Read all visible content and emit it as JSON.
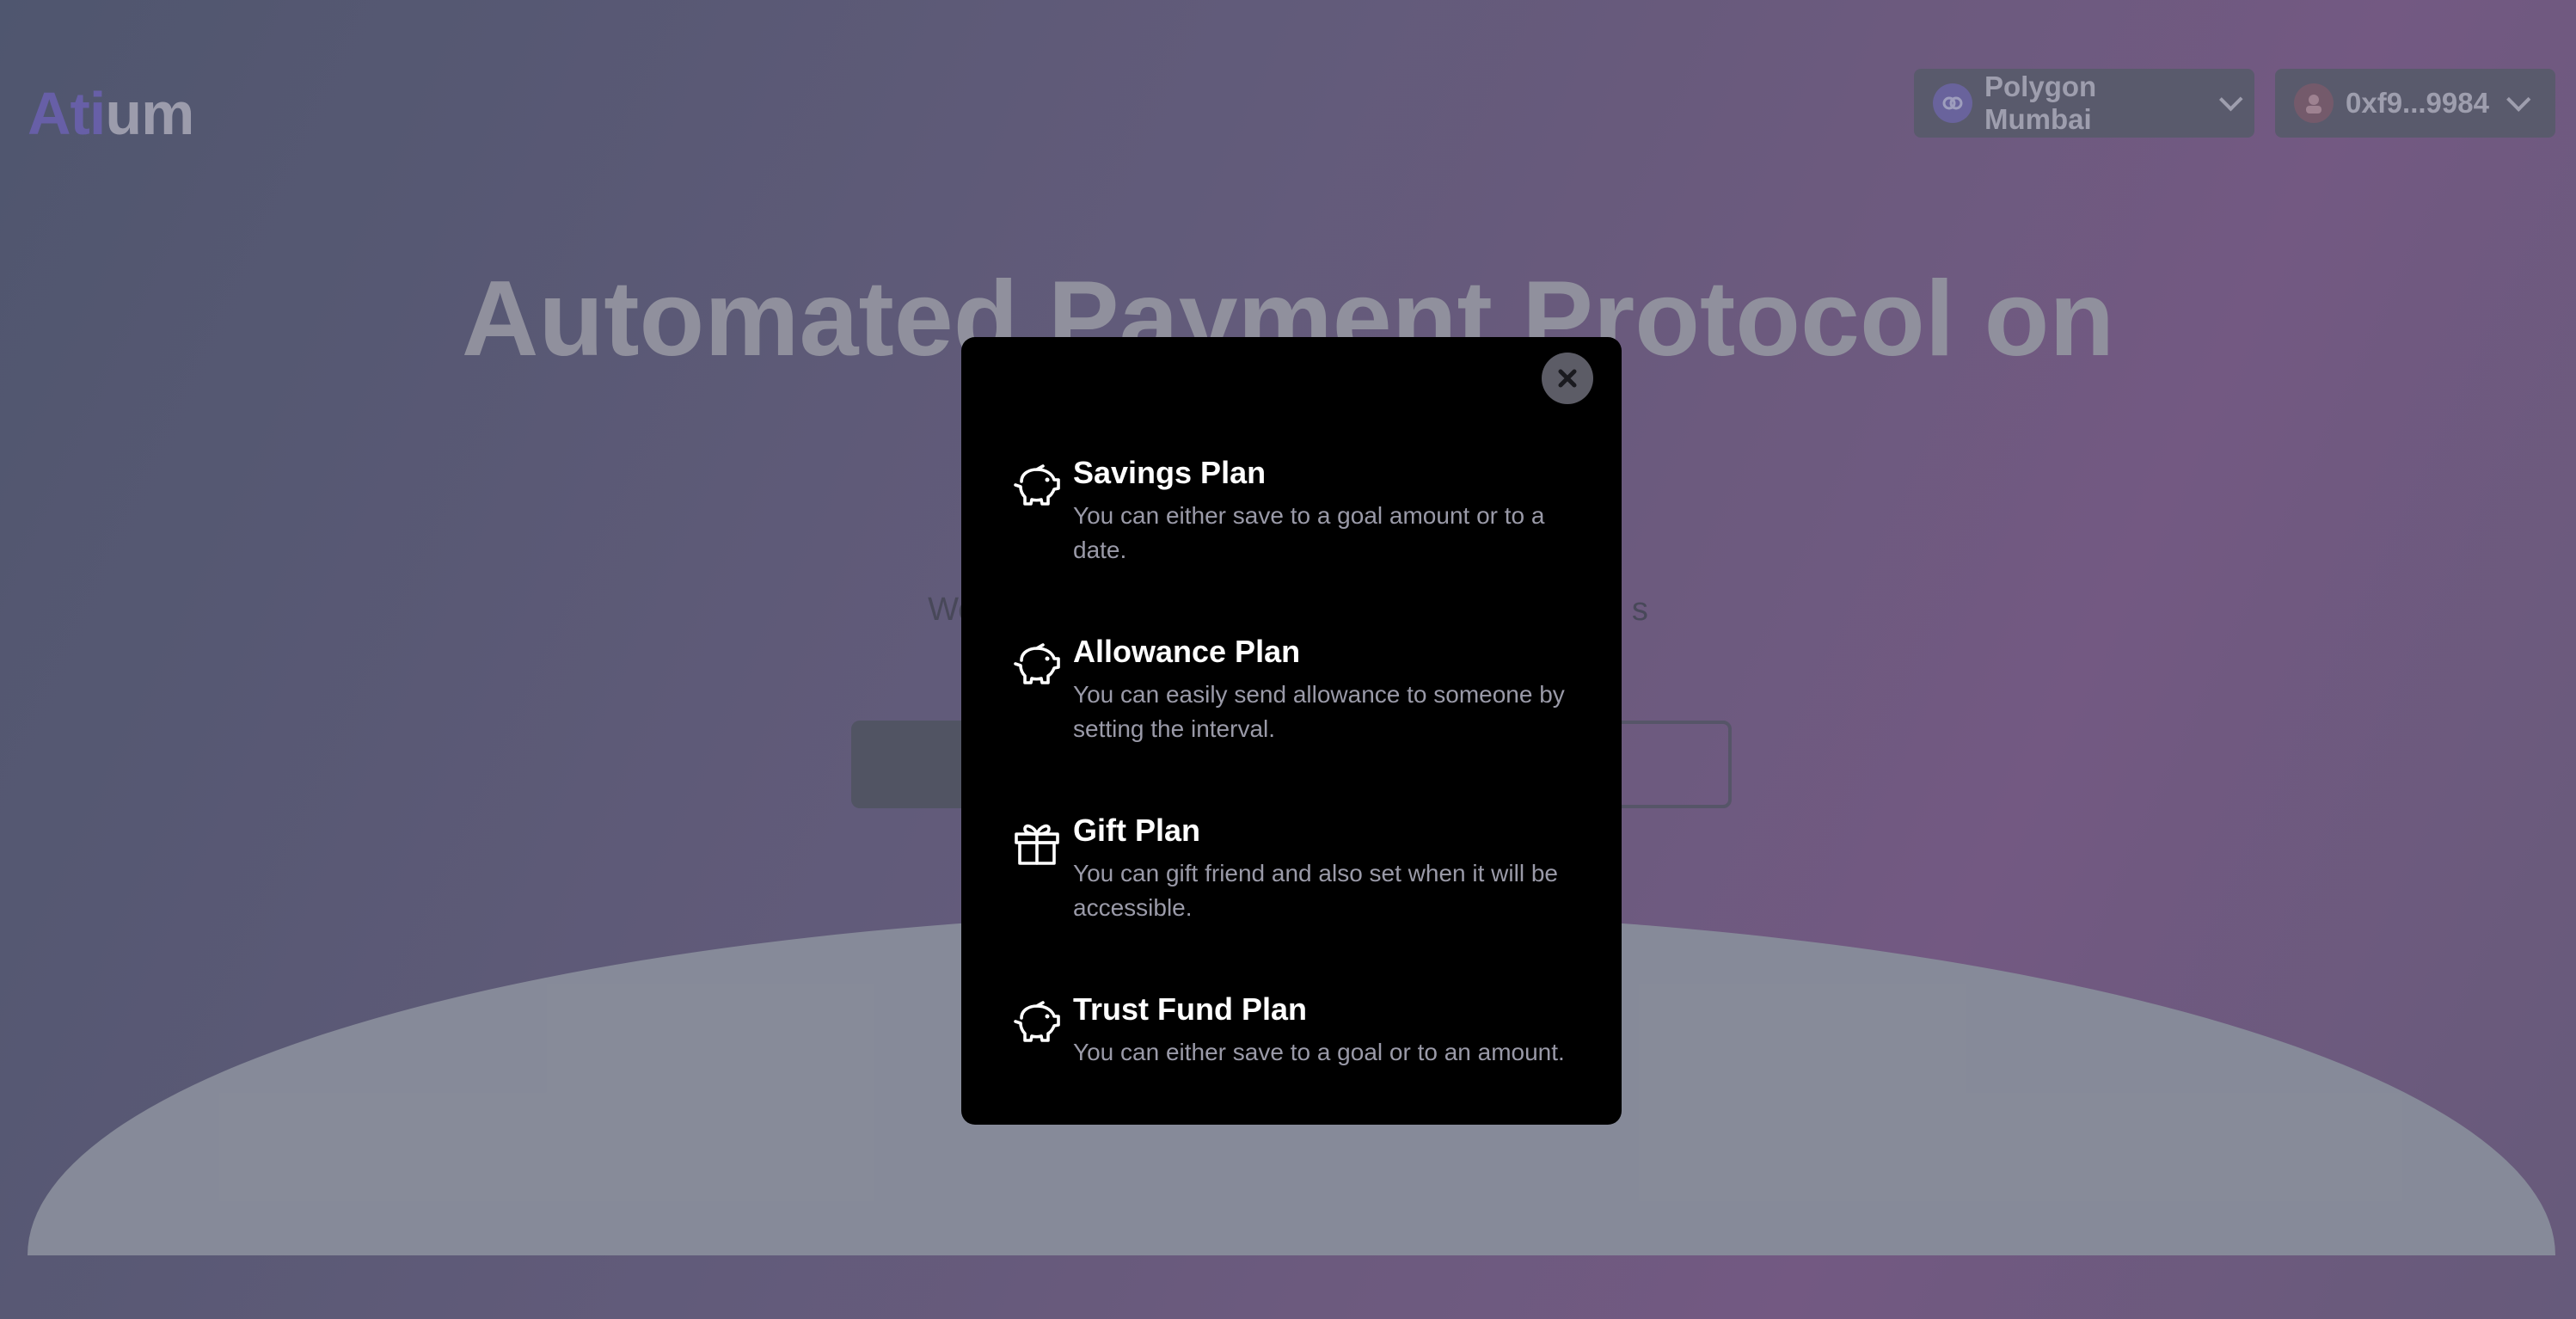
{
  "brand": {
    "logo_accent": "Ati",
    "logo_rest": "um"
  },
  "header": {
    "network": {
      "label": "Polygon Mumbai"
    },
    "wallet": {
      "label": "0xf9...9984"
    }
  },
  "hero": {
    "title": "Automated Payment Protocol on",
    "subtitle": "We want disburseme… tomated payment of a… s"
  },
  "modal": {
    "plans": [
      {
        "title": "Savings Plan",
        "description": "You can either save to a goal amount or to a date.",
        "icon": "piggy-bank-icon"
      },
      {
        "title": "Allowance Plan",
        "description": "You can easily send allowance to someone by setting the interval.",
        "icon": "piggy-bank-icon"
      },
      {
        "title": "Gift Plan",
        "description": "You can gift friend and also set when it will be accessible.",
        "icon": "gift-icon"
      },
      {
        "title": "Trust Fund Plan",
        "description": "You can either save to a goal or to an amount.",
        "icon": "piggy-bank-icon"
      }
    ]
  },
  "colors": {
    "modal_bg": "#000000",
    "text_primary": "#ffffff",
    "text_secondary": "#9a9aa8",
    "logo_accent": "#6d64b0"
  }
}
